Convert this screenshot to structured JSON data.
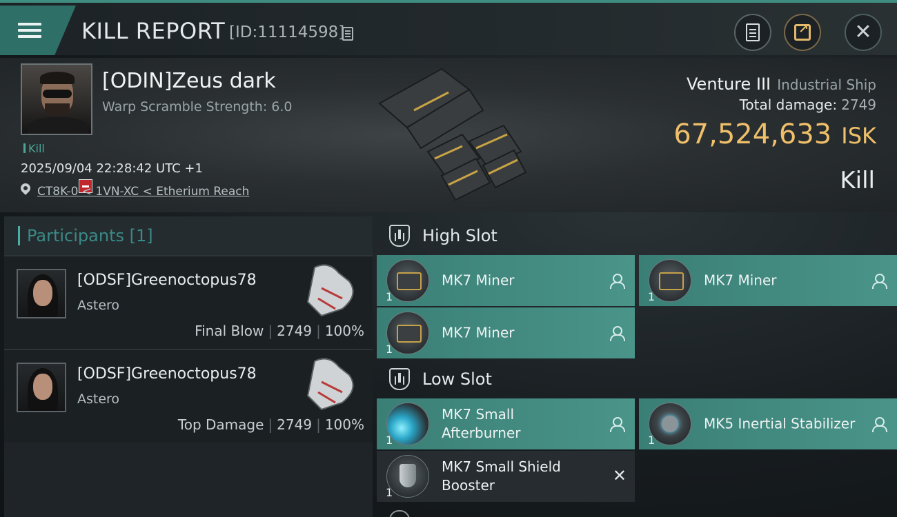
{
  "topbar": {
    "title": "KILL REPORT",
    "report_id": "[ID:11114598]",
    "icons": [
      "menu-icon",
      "copy-icon",
      "clipboard-icon",
      "share-icon",
      "close-icon"
    ]
  },
  "victim": {
    "name": "[ODIN]Zeus dark",
    "warp_scramble": "Warp Scramble Strength: 6.0",
    "tag": "Kill",
    "timestamp": "2025/09/04 22:28:42 UTC +1",
    "location": "CT8K-0 < 1VN-XC < Etherium Reach"
  },
  "ship": {
    "name": "Venture III",
    "class": "Industrial Ship",
    "total_damage_label": "Total damage:",
    "total_damage": "2749",
    "isk_value": "67,524,633",
    "isk_unit": "ISK",
    "result": "Kill"
  },
  "participants": {
    "header": "Participants [1]",
    "rows": [
      {
        "name": "[ODSF]Greenoctopus78",
        "ship": "Astero",
        "stat_label": "Final Blow",
        "damage": "2749",
        "percent": "100%"
      },
      {
        "name": "[ODSF]Greenoctopus78",
        "ship": "Astero",
        "stat_label": "Top Damage",
        "damage": "2749",
        "percent": "100%"
      }
    ]
  },
  "fitting": {
    "high_slot": {
      "title": "High Slot",
      "modules": [
        {
          "name": "MK7 Miner",
          "qty": "1",
          "status": "fitted"
        },
        {
          "name": "MK7 Miner",
          "qty": "1",
          "status": "fitted"
        },
        {
          "name": "MK7 Miner",
          "qty": "1",
          "status": "fitted"
        }
      ]
    },
    "low_slot": {
      "title": "Low Slot",
      "modules": [
        {
          "name": "MK7 Small Afterburner",
          "qty": "1",
          "status": "fitted"
        },
        {
          "name": "MK5 Inertial Stabilizer",
          "qty": "1",
          "status": "fitted"
        },
        {
          "name": "MK7 Small Shield Booster",
          "qty": "1",
          "status": "destroyed"
        }
      ]
    }
  },
  "colors": {
    "accent": "#3f8c80",
    "isk": "#f0bf6a",
    "fitted_module": "#4a9489",
    "loss_badge": "#c0262c"
  }
}
